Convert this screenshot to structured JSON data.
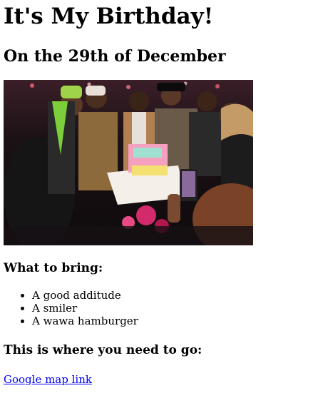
{
  "page": {
    "title": "It's My Birthday!",
    "date_heading": "On the 29th of December",
    "bring_heading": "What to bring:",
    "bring_items": [
      {
        "label": "A good additude"
      },
      {
        "label": "A smiler"
      },
      {
        "label": "A wawa hamburger"
      }
    ],
    "go_heading": "This is where you need to go:",
    "map_link": "Google map link"
  },
  "colors": {
    "link": "#0000ee",
    "text": "#000000",
    "background": "#ffffff"
  }
}
